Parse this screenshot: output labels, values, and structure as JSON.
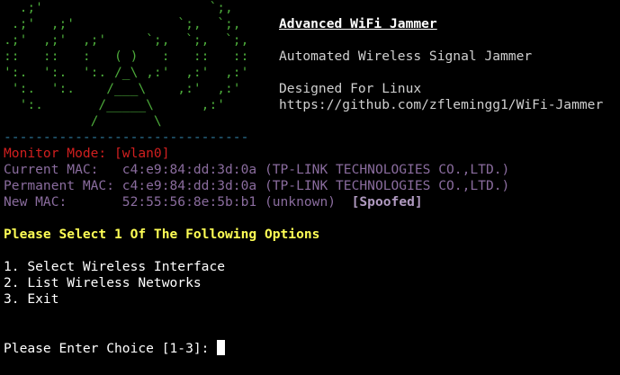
{
  "banner": {
    "ascii_rows": [
      "  .;'                     `;,",
      " .;'  ,;'             `;,  `;,",
      ".;'  ,;'  ,;'     `;,  `;,  `;,",
      "::   ::   :   ( )   :   ::   ::",
      "':.  ':.  ':. /_\\ ,:'  ,:'  ,:'",
      " ':.  ':.    /___\\    ,:'  ,:'",
      "  ':.       /_____\\      ,:'",
      "           /       \\"
    ],
    "title": "Advanced WiFi Jammer",
    "subtitle": "Automated Wireless Signal Jammer",
    "platform": "Designed For Linux",
    "url": "https://github.com/zflemingg1/WiFi-Jammer"
  },
  "divider": "-------------------------------",
  "status": {
    "monitor_mode_label": "Monitor Mode: [wlan0]",
    "current_mac_label": "Current MAC:   c4:e9:84:dd:3d:0a (TP-LINK TECHNOLOGIES CO.,LTD.)",
    "permanent_mac_label": "Permanent MAC: c4:e9:84:dd:3d:0a (TP-LINK TECHNOLOGIES CO.,LTD.)",
    "new_mac_label": "New MAC:       52:55:56:8e:5b:b1 (unknown)",
    "spoofed_tag": "[Spoofed]"
  },
  "menu": {
    "heading": "Please Select 1 Of The Following Options",
    "options": [
      "1. Select Wireless Interface",
      "2. List Wireless Networks",
      "3. Exit"
    ]
  },
  "prompt": {
    "text": "Please Enter Choice [1-3]: "
  },
  "colors": {
    "background": "#000000",
    "ascii_art": "#4caa3a",
    "divider": "#2e7a9e",
    "monitor_mode": "#d21f1f",
    "mac_info": "#8a6c9e",
    "heading": "#ffff55"
  }
}
